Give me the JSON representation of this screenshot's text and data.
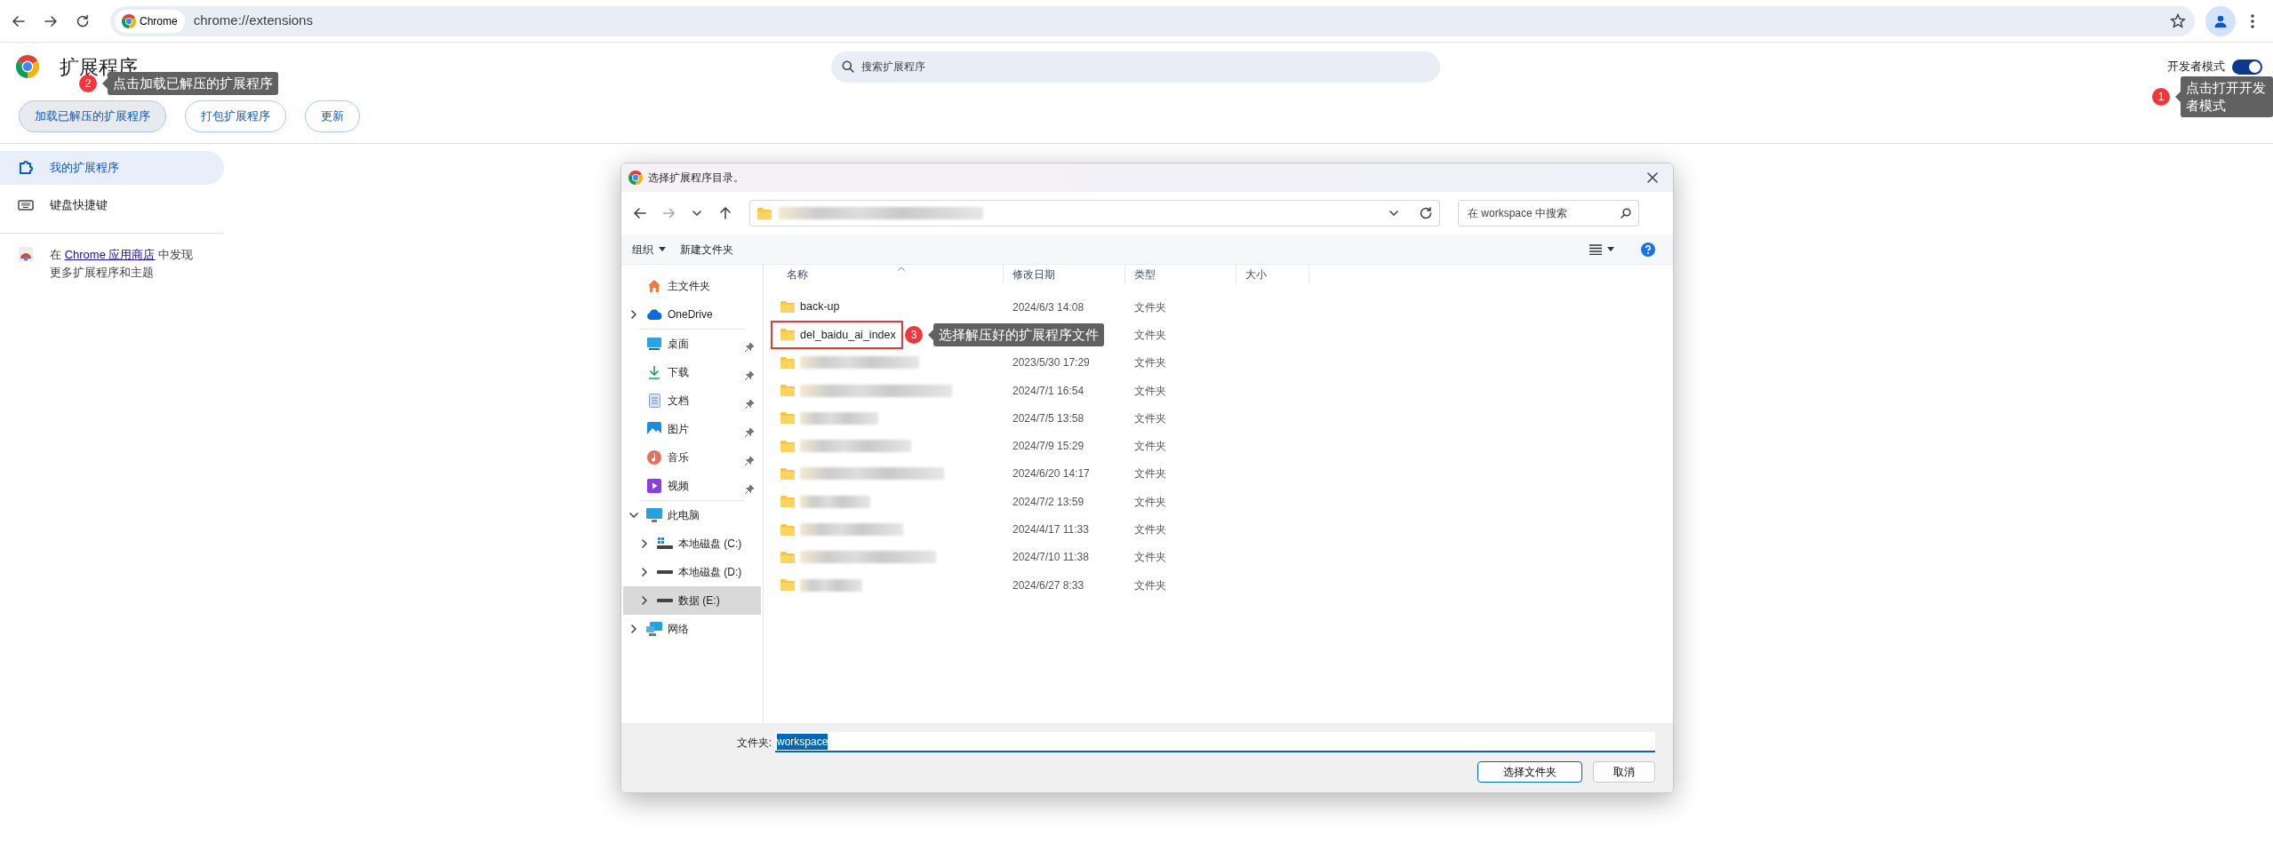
{
  "browser": {
    "site_chip": "Chrome",
    "url": "chrome://extensions"
  },
  "header": {
    "title": "扩展程序",
    "search": {
      "placeholder": "搜索扩展程序"
    },
    "dev_mode": {
      "label": "开发者模式",
      "on": true,
      "callout": {
        "number": "1",
        "text": "点击打开开发者模式"
      }
    },
    "buttons": [
      {
        "label": "加载已解压的扩展程序",
        "highlighted": true,
        "callout": {
          "number": "2",
          "text": "点击加载已解压的扩展程序"
        }
      },
      {
        "label": "打包扩展程序",
        "highlighted": false
      },
      {
        "label": "更新",
        "highlighted": false
      }
    ]
  },
  "sidebar": {
    "items": [
      {
        "label": "我的扩展程序",
        "kind": "extensions",
        "selected": true
      },
      {
        "label": "键盘快捷键",
        "kind": "keyboard",
        "selected": false
      }
    ],
    "store_prefix": "在 ",
    "store_link": "Chrome 应用商店",
    "store_suffix": " 中发现更多扩展程序和主题"
  },
  "dialog": {
    "title": "选择扩展程序目录。",
    "search": {
      "placeholder": "在 workspace 中搜索"
    },
    "commands": [
      {
        "label": "组织",
        "dropdown": true
      },
      {
        "label": "新建文件夹",
        "dropdown": false
      }
    ],
    "nav_groups": [
      [
        {
          "label": "主文件夹",
          "kind": "home"
        },
        {
          "label": "OneDrive",
          "kind": "cloud",
          "expanded": false
        }
      ],
      [
        {
          "label": "桌面",
          "kind": "desktop",
          "pinned": true
        },
        {
          "label": "下载",
          "kind": "download",
          "pinned": true
        },
        {
          "label": "文档",
          "kind": "document",
          "pinned": true
        },
        {
          "label": "图片",
          "kind": "picture",
          "pinned": true
        },
        {
          "label": "音乐",
          "kind": "music",
          "pinned": true
        },
        {
          "label": "视频",
          "kind": "video",
          "pinned": true
        }
      ],
      [
        {
          "label": "此电脑",
          "kind": "computer",
          "expanded": true,
          "children": [
            {
              "label": "本地磁盘 (C:)",
              "kind": "system-drive",
              "expanded": false,
              "selected": false
            },
            {
              "label": "本地磁盘 (D:)",
              "kind": "drive",
              "expanded": false,
              "selected": false
            },
            {
              "label": "数据 (E:)",
              "kind": "drive",
              "expanded": false,
              "selected": true
            }
          ]
        },
        {
          "label": "网络",
          "kind": "network",
          "expanded": false
        }
      ]
    ],
    "columns": [
      "名称",
      "修改日期",
      "类型",
      "大小"
    ],
    "rows": [
      {
        "kind": "named",
        "name": "back-up",
        "date": "2024/6/3 14:08",
        "type": "文件夹",
        "outlined": false
      },
      {
        "kind": "named",
        "name": "del_baidu_ai_index",
        "date": "",
        "type": "文件夹",
        "outlined": true,
        "callout": {
          "number": "3",
          "text": "选择解压好的扩展程序文件"
        }
      },
      {
        "kind": "blurred",
        "date": "2023/5/30 17:29",
        "type": "文件夹",
        "outlined": false
      },
      {
        "kind": "blurred",
        "date": "2024/7/1 16:54",
        "type": "文件夹",
        "outlined": false
      },
      {
        "kind": "blurred",
        "date": "2024/7/5 13:58",
        "type": "文件夹",
        "outlined": false
      },
      {
        "kind": "blurred",
        "date": "2024/7/9 15:29",
        "type": "文件夹",
        "outlined": false
      },
      {
        "kind": "blurred",
        "date": "2024/6/20 14:17",
        "type": "文件夹",
        "outlined": false
      },
      {
        "kind": "blurred",
        "date": "2024/7/2 13:59",
        "type": "文件夹",
        "outlined": false
      },
      {
        "kind": "blurred",
        "date": "2024/4/17 11:33",
        "type": "文件夹",
        "outlined": false
      },
      {
        "kind": "blurred",
        "date": "2024/7/10 11:38",
        "type": "文件夹",
        "outlined": false
      },
      {
        "kind": "blurred",
        "date": "2024/6/27 8:33",
        "type": "文件夹",
        "outlined": false
      }
    ],
    "folder_label": "文件夹:",
    "folder_value": "workspace",
    "buttons": [
      "选择文件夹",
      "取消"
    ]
  }
}
